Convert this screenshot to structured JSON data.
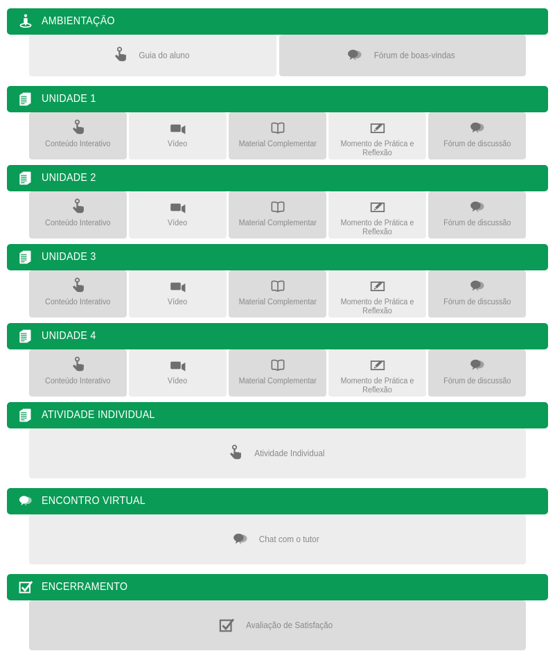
{
  "theme": {
    "accent_green": "#0a9b56",
    "tile_dark": "#dcdcdc",
    "tile_light": "#ededed",
    "label_gray": "#8a8a8a",
    "header_text": "#ffffff"
  },
  "sections": [
    {
      "title": "AMBIENTAÇÃO",
      "icon": "presenter-icon",
      "layout": "duo",
      "tiles": [
        {
          "label": "Guia do aluno",
          "icon": "touch-hand-icon",
          "shade": "light"
        },
        {
          "label": "Fórum de boas-vindas",
          "icon": "speech-bubbles-icon",
          "shade": "dark"
        }
      ]
    },
    {
      "title": "UNIDADE 1",
      "icon": "documents-icon",
      "layout": "unit",
      "tiles": [
        {
          "label": "Conteúdo Interativo",
          "icon": "touch-hand-icon",
          "shade": "dark"
        },
        {
          "label": "Vídeo",
          "icon": "video-camera-icon",
          "shade": "light"
        },
        {
          "label": "Material Complementar",
          "icon": "open-book-icon",
          "shade": "dark"
        },
        {
          "label": "Momento de Prática e Reflexão",
          "icon": "pencil-board-icon",
          "shade": "light"
        },
        {
          "label": "Fórum de discussão",
          "icon": "speech-bubbles-icon",
          "shade": "dark"
        }
      ]
    },
    {
      "title": "UNIDADE 2",
      "icon": "documents-icon",
      "layout": "unit",
      "tiles": [
        {
          "label": "Conteúdo Interativo",
          "icon": "touch-hand-icon",
          "shade": "dark"
        },
        {
          "label": "Vídeo",
          "icon": "video-camera-icon",
          "shade": "light"
        },
        {
          "label": "Material Complementar",
          "icon": "open-book-icon",
          "shade": "dark"
        },
        {
          "label": "Momento de Prática e Reflexão",
          "icon": "pencil-board-icon",
          "shade": "light"
        },
        {
          "label": "Fórum de discussão",
          "icon": "speech-bubbles-icon",
          "shade": "dark"
        }
      ]
    },
    {
      "title": "UNIDADE 3",
      "icon": "documents-icon",
      "layout": "unit",
      "tiles": [
        {
          "label": "Conteúdo Interativo",
          "icon": "touch-hand-icon",
          "shade": "dark"
        },
        {
          "label": "Vídeo",
          "icon": "video-camera-icon",
          "shade": "light"
        },
        {
          "label": "Material Complementar",
          "icon": "open-book-icon",
          "shade": "dark"
        },
        {
          "label": "Momento de Prática e Reflexão",
          "icon": "pencil-board-icon",
          "shade": "light"
        },
        {
          "label": "Fórum de discussão",
          "icon": "speech-bubbles-icon",
          "shade": "dark"
        }
      ]
    },
    {
      "title": "UNIDADE 4",
      "icon": "documents-icon",
      "layout": "unit",
      "tiles": [
        {
          "label": "Conteúdo Interativo",
          "icon": "touch-hand-icon",
          "shade": "dark"
        },
        {
          "label": "Vídeo",
          "icon": "video-camera-icon",
          "shade": "light"
        },
        {
          "label": "Material Complementar",
          "icon": "open-book-icon",
          "shade": "dark"
        },
        {
          "label": "Momento de Prática e Reflexão",
          "icon": "pencil-board-icon",
          "shade": "light"
        },
        {
          "label": "Fórum de discussão",
          "icon": "speech-bubbles-icon",
          "shade": "dark"
        }
      ]
    },
    {
      "title": "ATIVIDADE INDIVIDUAL",
      "icon": "documents-icon",
      "layout": "single",
      "tiles": [
        {
          "label": "Atividade Individual",
          "icon": "touch-hand-icon",
          "shade": "light"
        }
      ]
    },
    {
      "title": "ENCONTRO VIRTUAL",
      "icon": "speech-bubbles-icon",
      "layout": "single",
      "tiles": [
        {
          "label": "Chat com o tutor",
          "icon": "speech-bubbles-icon",
          "shade": "light"
        }
      ]
    },
    {
      "title": "ENCERRAMENTO",
      "icon": "checkbox-check-icon",
      "layout": "single",
      "tiles": [
        {
          "label": "Avaliação de Satisfação",
          "icon": "checkbox-check-icon",
          "shade": "dark"
        }
      ]
    }
  ]
}
